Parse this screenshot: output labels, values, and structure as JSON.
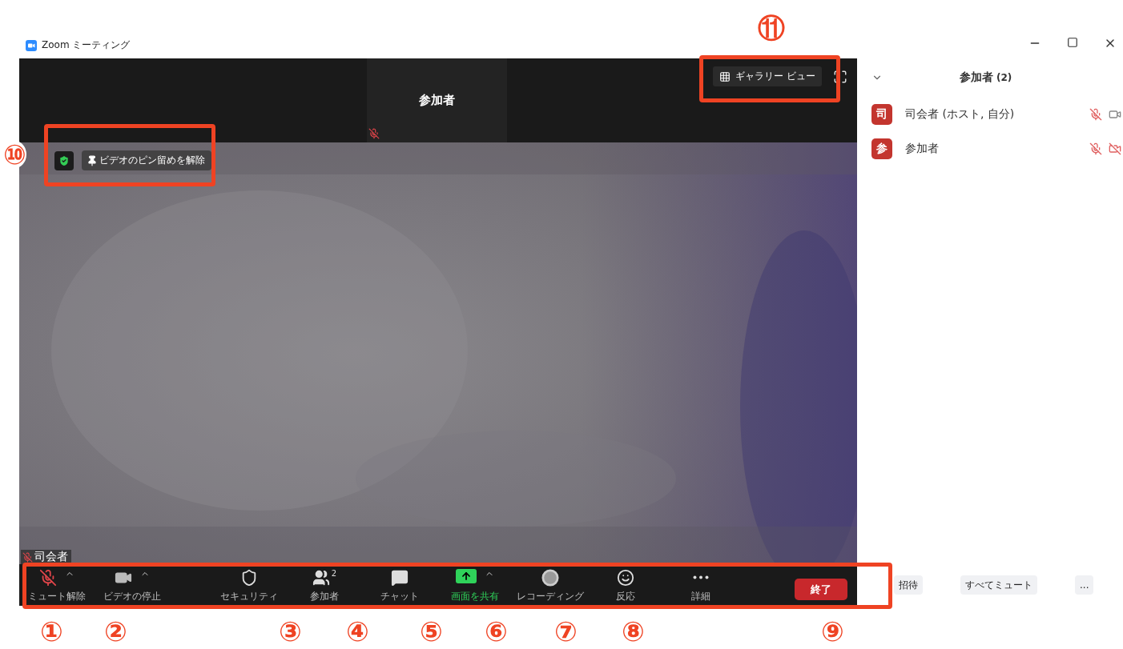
{
  "window": {
    "title": "Zoom ミーティング"
  },
  "top_strip": {
    "participant_tile": {
      "name": "参加者",
      "muted": true
    },
    "gallery_view_button": "ギャラリー ビュー"
  },
  "video": {
    "unpin_button": "ビデオのピン留めを解除",
    "name_label": {
      "name": "司会者",
      "muted": true
    }
  },
  "toolbar": {
    "items": [
      {
        "kind": "mic",
        "label": "ミュート解除",
        "muted": true,
        "caret": true
      },
      {
        "kind": "camera",
        "label": "ビデオの停止",
        "muted": false,
        "caret": true
      },
      {
        "kind": "security",
        "label": "セキュリティ",
        "caret": false
      },
      {
        "kind": "participants",
        "label": "参加者",
        "badge": "2",
        "caret": false
      },
      {
        "kind": "chat",
        "label": "チャット",
        "caret": false
      },
      {
        "kind": "share",
        "label": "画面を共有",
        "caret": true
      },
      {
        "kind": "record",
        "label": "レコーディング",
        "caret": false
      },
      {
        "kind": "reaction",
        "label": "反応",
        "caret": false
      },
      {
        "kind": "more",
        "label": "詳細",
        "caret": false
      }
    ],
    "end_button": "終了"
  },
  "participants_panel": {
    "title": "参加者",
    "count": "(2)",
    "participants": [
      {
        "avatar": "司",
        "name": "司会者 (ホスト, 自分)",
        "muted": true,
        "video_off": false
      },
      {
        "avatar": "参",
        "name": "参加者",
        "muted": true,
        "video_off": true
      }
    ],
    "buttons": [
      "招待",
      "すべてミュート",
      "..."
    ]
  },
  "annotations": {
    "markers": [
      "①",
      "②",
      "③",
      "④",
      "⑤",
      "⑥",
      "⑦",
      "⑧",
      "⑨",
      "⑩",
      "⑪"
    ]
  }
}
